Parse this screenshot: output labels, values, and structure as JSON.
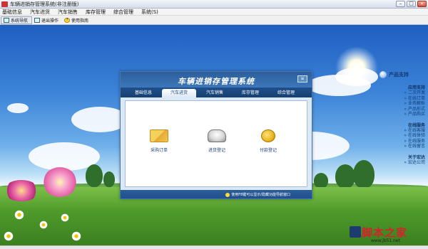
{
  "window": {
    "title": "车辆进销存管理系统(非注册版)",
    "controls": {
      "minimize": "–",
      "maximize": "□",
      "close": "×"
    }
  },
  "menu": [
    "基础信息",
    "汽车进货",
    "汽车销售",
    "库存管理",
    "综合管理",
    "系统(S)"
  ],
  "toolbar": [
    {
      "label": "系统导航",
      "icon": "navigation-icon"
    },
    {
      "label": "退出操作",
      "icon": "exit-icon"
    },
    {
      "label": "使用指南",
      "icon": "help-icon"
    }
  ],
  "panel": {
    "title": "车辆进销存管理系统",
    "close_label": "≡",
    "tabs": [
      "基础信息",
      "汽车进货",
      "汽车销售",
      "库存管理",
      "综合管理"
    ],
    "active_tab": 1,
    "actions": [
      {
        "label": "采购订单",
        "icon": "purchase-order-icon"
      },
      {
        "label": "进货登记",
        "icon": "car-icon"
      },
      {
        "label": "付款登记",
        "icon": "coins-icon"
      }
    ],
    "footer_hint": "使用F8键可以显示/隐藏功能导航窗口"
  },
  "sidebar": {
    "title": "产品支持",
    "sections": [
      {
        "heading": "应用支持",
        "links": [
          "二次开发",
          "在线订单",
          "业务解析",
          "产品形式",
          "产品购买"
        ]
      },
      {
        "heading": "在线服务",
        "links": [
          "在线客服",
          "在线体验",
          "在线服务",
          "在线留言"
        ]
      },
      {
        "heading": "关于宏达",
        "links": [
          "宏达公司"
        ]
      }
    ]
  },
  "watermark": {
    "text": "脚本之家",
    "sub": "www.jb51.net"
  },
  "colors": {
    "panel_header": "#2c5e9a",
    "tab_bar": "#1f4f8c",
    "link": "#0d3b73",
    "watermark": "#d5222a"
  }
}
